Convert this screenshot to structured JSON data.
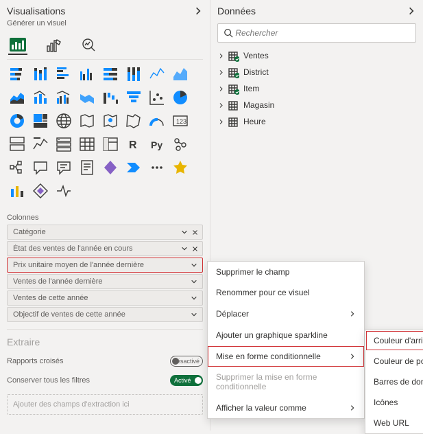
{
  "panes": {
    "viz": {
      "title": "Visualisations",
      "sub": "Générer un visuel"
    },
    "data": {
      "title": "Données"
    }
  },
  "columns": {
    "label": "Colonnes",
    "fields": [
      {
        "label": "Catégorie",
        "closable": true
      },
      {
        "label": "État des ventes de l'année en cours",
        "closable": true
      },
      {
        "label": "Prix unitaire moyen de l'année dernière",
        "closable": false,
        "hl": true
      },
      {
        "label": "Ventes de l'année dernière",
        "closable": false
      },
      {
        "label": "Ventes de cette année",
        "closable": false
      },
      {
        "label": "Objectif de ventes de cette année",
        "closable": false
      }
    ]
  },
  "extract": {
    "title": "Extraire",
    "cross": {
      "label": "Rapports croisés",
      "state": "Désactivé"
    },
    "keep": {
      "label": "Conserver tous les filtres",
      "state": "Activé"
    },
    "drop": "Ajouter des champs d'extraction ici"
  },
  "search": {
    "placeholder": "Rechercher"
  },
  "tables": [
    "Ventes",
    "District",
    "Item",
    "Magasin",
    "Heure"
  ],
  "menu1": {
    "remove": "Supprimer le champ",
    "rename": "Renommer pour ce visuel",
    "move": "Déplacer",
    "sparkline": "Ajouter un graphique sparkline",
    "cond": "Mise en forme conditionnelle",
    "delcond": "Supprimer la mise en forme conditionnelle",
    "showas": "Afficher la valeur comme"
  },
  "menu2": {
    "bg": "Couleur d'arrière-plan",
    "font": "Couleur de police",
    "bars": "Barres de données",
    "icons": "Icônes",
    "url": "Web URL"
  }
}
